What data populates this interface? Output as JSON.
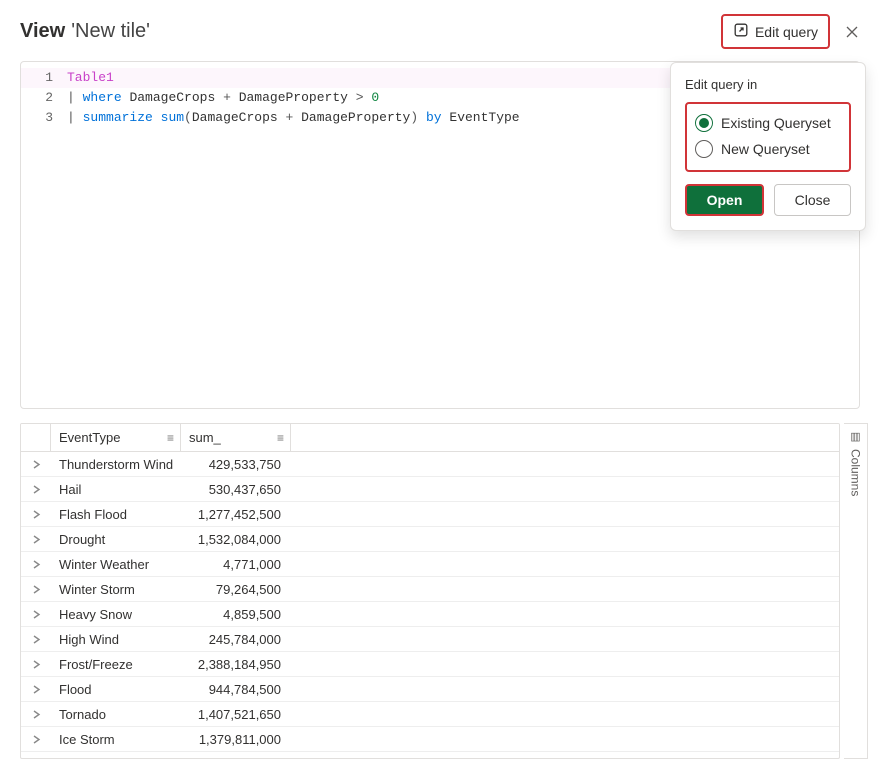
{
  "header": {
    "view_label": "View",
    "tile_name": "'New tile'",
    "edit_query_label": "Edit query"
  },
  "code": {
    "lines": [
      {
        "n": "1",
        "raw": "Table1"
      },
      {
        "n": "2",
        "raw": "| where DamageCrops + DamageProperty > 0"
      },
      {
        "n": "3",
        "raw": "| summarize sum(DamageCrops + DamageProperty) by EventType"
      }
    ]
  },
  "popover": {
    "title": "Edit query in",
    "options": [
      {
        "label": "Existing Queryset",
        "selected": true
      },
      {
        "label": "New Queryset",
        "selected": false
      }
    ],
    "open_label": "Open",
    "close_label": "Close"
  },
  "grid": {
    "columns": [
      "EventType",
      "sum_"
    ],
    "rows": [
      {
        "event": "Thunderstorm Wind",
        "sum": "429,533,750"
      },
      {
        "event": "Hail",
        "sum": "530,437,650"
      },
      {
        "event": "Flash Flood",
        "sum": "1,277,452,500"
      },
      {
        "event": "Drought",
        "sum": "1,532,084,000"
      },
      {
        "event": "Winter Weather",
        "sum": "4,771,000"
      },
      {
        "event": "Winter Storm",
        "sum": "79,264,500"
      },
      {
        "event": "Heavy Snow",
        "sum": "4,859,500"
      },
      {
        "event": "High Wind",
        "sum": "245,784,000"
      },
      {
        "event": "Frost/Freeze",
        "sum": "2,388,184,950"
      },
      {
        "event": "Flood",
        "sum": "944,784,500"
      },
      {
        "event": "Tornado",
        "sum": "1,407,521,650"
      },
      {
        "event": "Ice Storm",
        "sum": "1,379,811,000"
      }
    ],
    "columns_tab": "Columns"
  }
}
